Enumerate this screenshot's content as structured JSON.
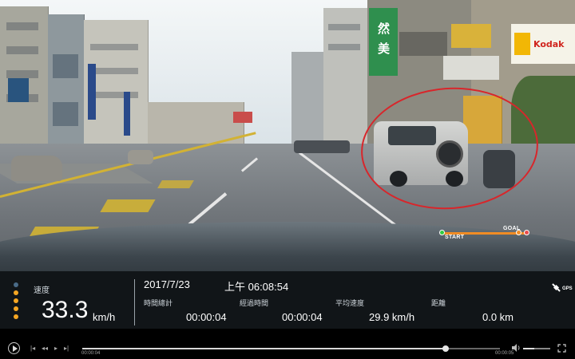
{
  "video": {
    "overlay_labels": {
      "start": "START",
      "goal": "GOAL"
    },
    "signs": {
      "kodak": "Kodak",
      "vertical_sign": "然美"
    },
    "colors": {
      "highlight_circle": "#d8262b",
      "route": "#f08c24",
      "start_dot": "#2ecc40",
      "goal_dot": "#e84b4b"
    }
  },
  "panel": {
    "speed": {
      "label": "速度",
      "value": "33.3",
      "unit": "km/h"
    },
    "date": "2017/7/23",
    "time": "上午 06:08:54",
    "gps_label": "GPS",
    "stats": [
      {
        "label": "時間總計",
        "value": "00:00:04"
      },
      {
        "label": "經過時間",
        "value": "00:00:04"
      },
      {
        "label": "平均速度",
        "value": "29.9 km/h"
      },
      {
        "label": "距離",
        "value": "0.0 km"
      }
    ],
    "led_colors": [
      "#4a6b88",
      "#f5a623",
      "#f5a623",
      "#f5a623",
      "#f5a623"
    ]
  },
  "player": {
    "current_time": "00:00:04",
    "total_time": "00:00:05",
    "progress": 0.87,
    "volume": 0.4
  }
}
